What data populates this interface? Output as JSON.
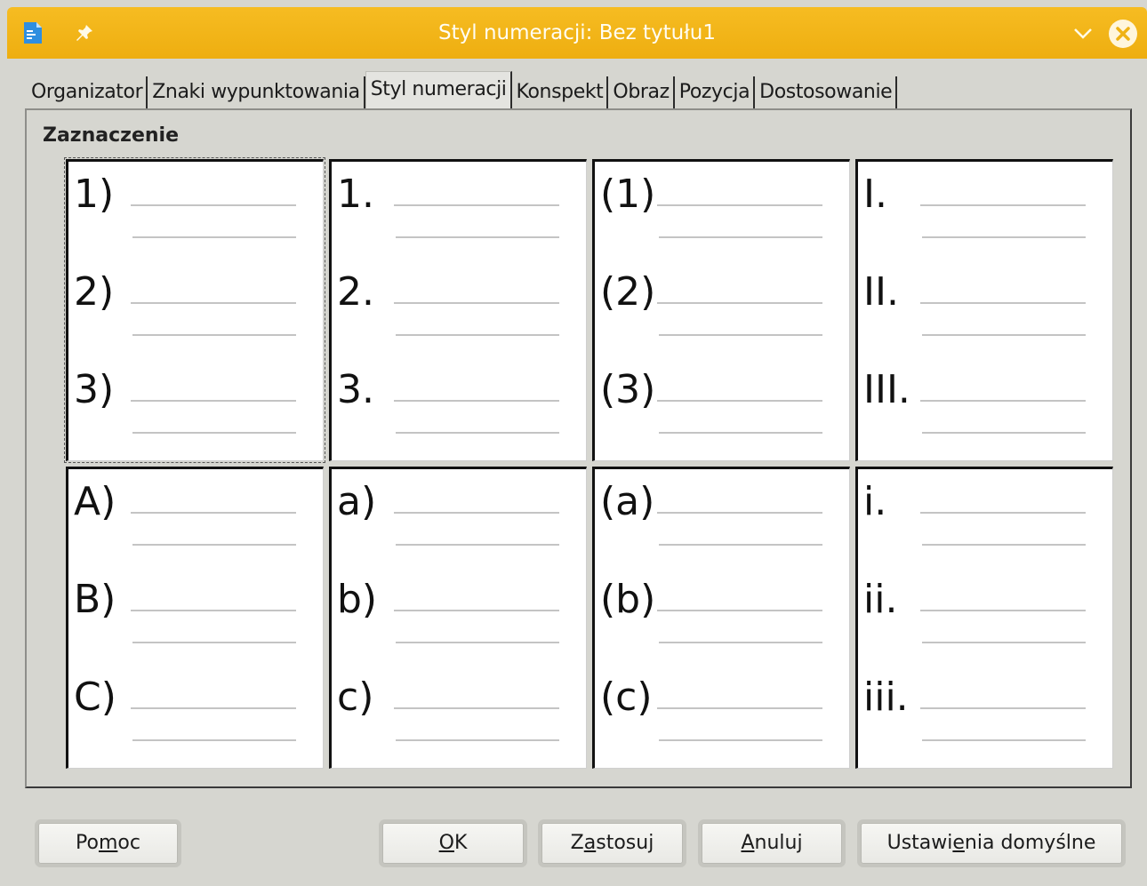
{
  "window": {
    "title": "Styl numeracji: Bez tytułu1",
    "accent_color": "#efb214"
  },
  "tabs": [
    {
      "label": "Organizator",
      "active": false
    },
    {
      "label": "Znaki wypunktowania",
      "active": false
    },
    {
      "label": "Styl numeracji",
      "active": true
    },
    {
      "label": "Konspekt",
      "active": false
    },
    {
      "label": "Obraz",
      "active": false
    },
    {
      "label": "Pozycja",
      "active": false
    },
    {
      "label": "Dostosowanie",
      "active": false
    }
  ],
  "section": {
    "label": "Zaznaczenie"
  },
  "presets": [
    {
      "items": [
        "1)",
        "2)",
        "3)"
      ],
      "selected": true
    },
    {
      "items": [
        "1.",
        "2.",
        "3."
      ],
      "selected": false
    },
    {
      "items": [
        "(1)",
        "(2)",
        "(3)"
      ],
      "selected": false
    },
    {
      "items": [
        "I.",
        "II.",
        "III."
      ],
      "selected": false
    },
    {
      "items": [
        "A)",
        "B)",
        "C)"
      ],
      "selected": false
    },
    {
      "items": [
        "a)",
        "b)",
        "c)"
      ],
      "selected": false
    },
    {
      "items": [
        "(a)",
        "(b)",
        "(c)"
      ],
      "selected": false
    },
    {
      "items": [
        "i.",
        "ii.",
        "iii."
      ],
      "selected": false
    }
  ],
  "buttons": {
    "help": {
      "pre": "Po",
      "mnemonic": "m",
      "post": "oc"
    },
    "ok": {
      "pre": "",
      "mnemonic": "O",
      "post": "K"
    },
    "apply": {
      "pre": "Z",
      "mnemonic": "a",
      "post": "stosuj"
    },
    "cancel": {
      "pre": "",
      "mnemonic": "A",
      "post": "nuluj"
    },
    "reset": {
      "pre": "Ustawi",
      "mnemonic": "e",
      "post": "nia domyślne"
    }
  }
}
